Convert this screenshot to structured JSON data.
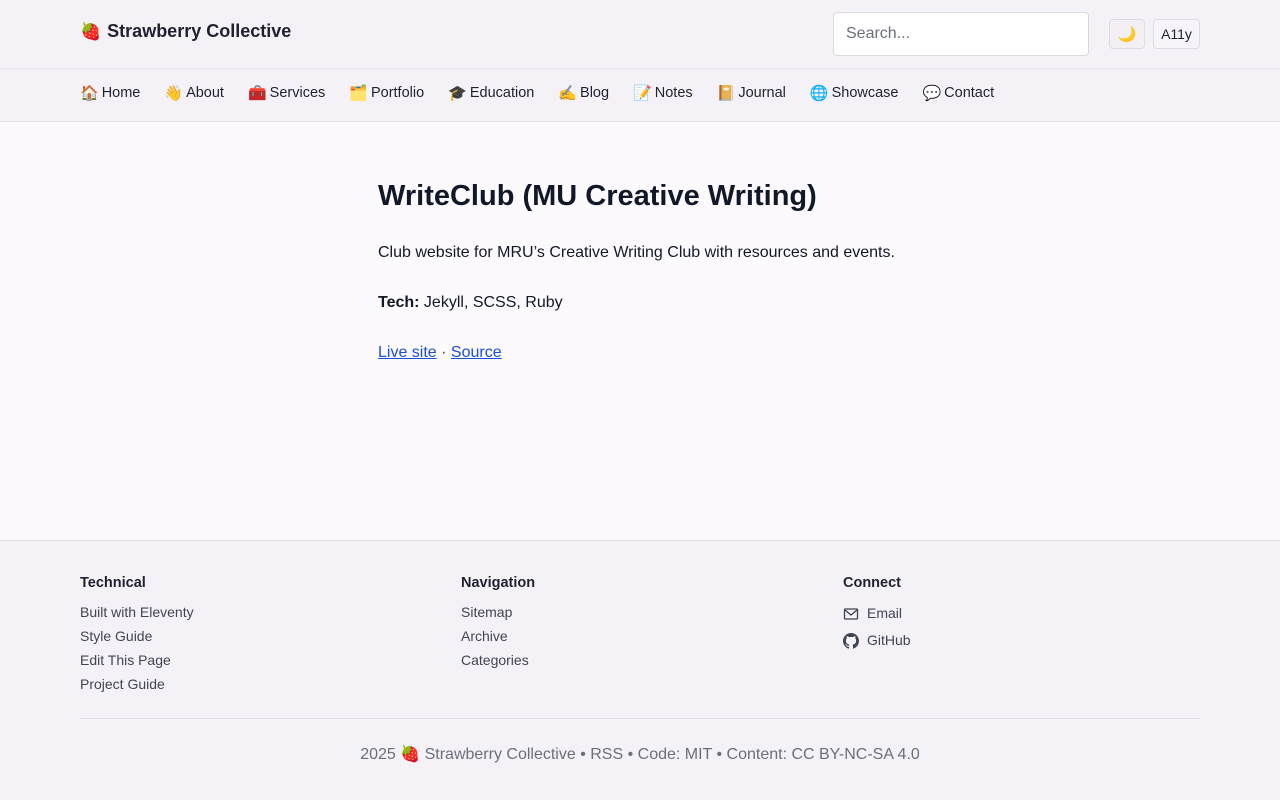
{
  "header": {
    "brand_emoji": "🍓",
    "brand_name": "Strawberry Collective",
    "search_placeholder": "Search...",
    "theme_toggle_icon": "🌙",
    "a11y_label": "A11y"
  },
  "nav": {
    "items": [
      {
        "icon": "🏠",
        "label": "Home"
      },
      {
        "icon": "👋",
        "label": "About"
      },
      {
        "icon": "🧰",
        "label": "Services"
      },
      {
        "icon": "🗂️",
        "label": "Portfolio"
      },
      {
        "icon": "🎓",
        "label": "Education"
      },
      {
        "icon": "✍️",
        "label": "Blog"
      },
      {
        "icon": "📝",
        "label": "Notes"
      },
      {
        "icon": "📔",
        "label": "Journal"
      },
      {
        "icon": "🌐",
        "label": "Showcase"
      },
      {
        "icon": "💬",
        "label": "Contact"
      }
    ]
  },
  "main": {
    "title": "WriteClub (MU Creative Writing)",
    "description": "Club website for MRU’s Creative Writing Club with resources and events.",
    "tech_label": "Tech:",
    "tech_value": " Jekyll, SCSS, Ruby",
    "live_link": "Live site",
    "separator": " · ",
    "source_link": "Source"
  },
  "footer": {
    "technical": {
      "heading": "Technical",
      "links": [
        "Built with Eleventy",
        "Style Guide",
        "Edit This Page",
        "Project Guide"
      ]
    },
    "navigation": {
      "heading": "Navigation",
      "links": [
        "Sitemap",
        "Archive",
        "Categories"
      ]
    },
    "connect": {
      "heading": "Connect",
      "email": "Email",
      "github": "GitHub"
    },
    "copyright": "2025 🍓 Strawberry Collective • RSS • Code: MIT • Content: CC BY-NC-SA 4.0"
  }
}
